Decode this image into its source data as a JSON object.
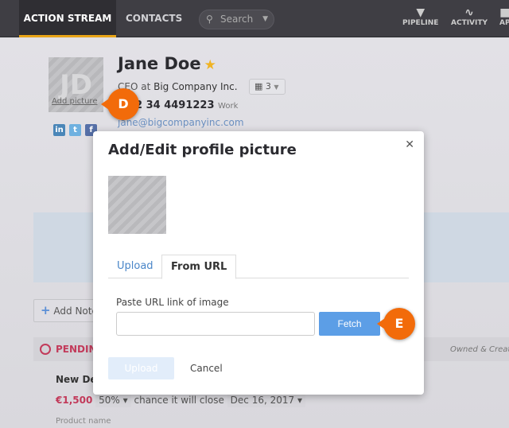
{
  "nav": {
    "tabs": [
      "ACTION STREAM",
      "CONTACTS"
    ],
    "search_placeholder": "Search",
    "icons": [
      {
        "label": "PIPELINE",
        "icon": "funnel-icon"
      },
      {
        "label": "ACTIVITY",
        "icon": "pulse-icon"
      },
      {
        "label": "AP",
        "icon": "apps-icon"
      }
    ]
  },
  "contact": {
    "initials": "JD",
    "add_picture": "Add picture",
    "name": "Jane Doe",
    "role": "CEO at",
    "company": "Big Company Inc.",
    "companies_count": "3",
    "phone": "2 34 4491223",
    "phone_type": "Work",
    "email": "jane@bigcompanyinc.com"
  },
  "background": {
    "add_note": "Add Note",
    "pending": "PENDIN",
    "owned": "Owned & Creat",
    "deal_title": "New De",
    "amount": "€1,500",
    "probability": "50%",
    "chance_text": "chance it will close",
    "close_date": "Dec 16, 2017",
    "product_label": "Product name"
  },
  "modal": {
    "title": "Add/Edit profile picture",
    "tabs": [
      "Upload",
      "From URL"
    ],
    "url_label": "Paste URL link of image",
    "url_value": "",
    "fetch": "Fetch",
    "upload": "Upload",
    "cancel": "Cancel"
  },
  "annotations": {
    "d": "D",
    "e": "E"
  },
  "colors": {
    "accent": "#5c9ee6",
    "badge": "#f26b0a",
    "pending": "#c23a5a"
  }
}
